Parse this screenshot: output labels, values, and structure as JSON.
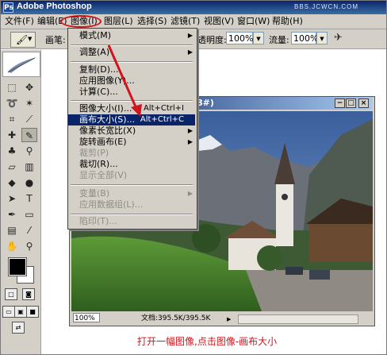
{
  "app": {
    "title": "Adobe Photoshop",
    "watermark": "BBS.JCWCN.COM",
    "logo": "Ps"
  },
  "menubar": {
    "items": [
      {
        "label": "文件(F)"
      },
      {
        "label": "编辑(E)"
      },
      {
        "label": "图像(I)"
      },
      {
        "label": "图层(L)"
      },
      {
        "label": "选择(S)"
      },
      {
        "label": "滤镜(T)"
      },
      {
        "label": "视图(V)"
      },
      {
        "label": "窗口(W)"
      },
      {
        "label": "帮助(H)"
      }
    ]
  },
  "options": {
    "brush_label": "画笔:",
    "opacity_label": "透明度:",
    "opacity_value": "100%",
    "flow_label": "流量:",
    "flow_value": "100%"
  },
  "image_menu": {
    "items": [
      {
        "label": "模式(M)",
        "submenu": true
      },
      {
        "label": "调整(A)",
        "submenu": true
      },
      {
        "label": "复制(D)..."
      },
      {
        "label": "应用图像(Y)..."
      },
      {
        "label": "计算(C)..."
      },
      {
        "label": "图像大小(I)...",
        "shortcut": "Alt+Ctrl+I"
      },
      {
        "label": "画布大小(S)...",
        "shortcut": "Alt+Ctrl+C",
        "highlighted": true
      },
      {
        "label": "像素长宽比(X)",
        "submenu": true
      },
      {
        "label": "旋转画布(E)",
        "submenu": true
      },
      {
        "label": "裁剪(P)",
        "disabled": true
      },
      {
        "label": "裁切(R)..."
      },
      {
        "label": "显示全部(V)",
        "disabled": true
      },
      {
        "label": "变量(B)",
        "submenu": true,
        "disabled": true
      },
      {
        "label": "应用数据组(L)...",
        "disabled": true
      },
      {
        "label": "陷印(T)...",
        "disabled": true
      }
    ]
  },
  "document": {
    "title_fragment": "8#)",
    "zoom": "100%",
    "info": "文档:395.5K/395.5K"
  },
  "caption": "打开一幅图像,点击图像-画布大小",
  "colors": {
    "accent_red": "#d0141e",
    "menu_highlight": "#0a246a",
    "chrome": "#d4d0c8"
  },
  "icons": {
    "min": "−",
    "max": "□",
    "close": "×",
    "submenu": "▶",
    "dropdown": "▼",
    "brush": "🖌",
    "airbrush": "✈"
  }
}
